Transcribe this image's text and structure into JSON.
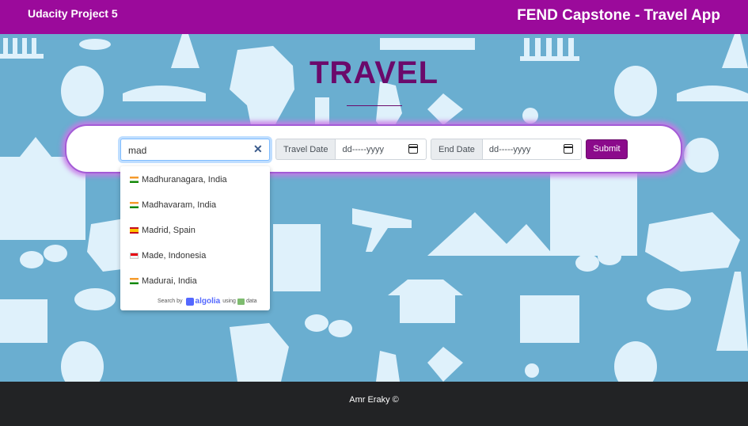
{
  "navbar": {
    "brand_left": "Udacity Project 5",
    "brand_right": "FEND Capstone - Travel App",
    "color": "#9b0a9b"
  },
  "hero": {
    "title": "TRAVEL",
    "color": "#6b0a6b"
  },
  "form": {
    "place_value": "mad",
    "travel_date_label": "Travel Date",
    "travel_date_value": "dd-----yyyy",
    "end_date_label": "End Date",
    "end_date_value": "dd-----yyyy",
    "submit_label": "Submit"
  },
  "suggestions": [
    {
      "flag": "in",
      "label": "Madhuranagara, India"
    },
    {
      "flag": "in",
      "label": "Madhavaram, India"
    },
    {
      "flag": "es",
      "label": "Madrid, Spain"
    },
    {
      "flag": "id",
      "label": "Made, Indonesia"
    },
    {
      "flag": "in",
      "label": "Madurai, India"
    }
  ],
  "powered_by": {
    "prefix": "Search by",
    "brand": "algolia",
    "suffix_a": "using",
    "suffix_b": "data"
  },
  "footer": {
    "text": "Amr Eraky ©"
  }
}
